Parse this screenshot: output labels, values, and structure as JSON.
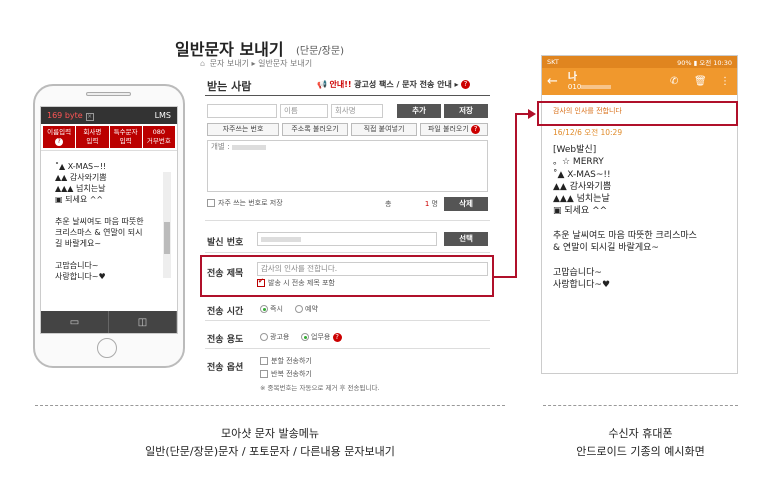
{
  "heading": {
    "title": "일반문자 보내기",
    "subtitle": "(단문/장문)",
    "breadcrumb_1": "문자 보내기",
    "breadcrumb_2": "일반문자 보내기"
  },
  "left_phone": {
    "byte_count": "169 byte",
    "mode": "LMS",
    "tabs": [
      "이름입력",
      "회사명\n입력",
      "특수문자\n입력",
      "080\n거부번호"
    ],
    "message": "˚▲  X-MAS~!!\n▲▲ 감사와기쁨\n▲▲▲ 넘치는날\n ▣  되세요 ^^\n\n추운 날씨여도 마음 따뜻한\n크리스마스 & 연말이 되시\n길 바랄게요~\n\n고맙습니다~\n사랑합니다~♥"
  },
  "form": {
    "recipient_label": "받는 사람",
    "notice_label": "안내!!",
    "notice_text": "광고성 팩스 / 문자 전송 안내",
    "phone_placeholder": "",
    "name_placeholder": "이름",
    "company_placeholder": "회사명",
    "add_button": "추가",
    "save_button": "저장",
    "btn_frequent": "자주쓰는 번호",
    "btn_address": "주소록 불러오기",
    "btn_direct": "직접 붙여넣기",
    "btn_file": "파일 불러오기",
    "recipient_list_prefix": "개별 : ",
    "save_frequent_label": "자주 쓰는 번호로 저장",
    "total_label": "총",
    "total_count": "1",
    "total_unit": "명",
    "delete_button": "삭제",
    "sender_label": "발신 번호",
    "select_button": "선택",
    "subject_label": "전송 제목",
    "subject_value": "감사의 인사를 전합니다.",
    "include_subject_label": "발송 시 전송 제목 포함",
    "time_label": "전송 시간",
    "time_now": "즉시",
    "time_reserve": "예약",
    "purpose_label": "전송 용도",
    "purpose_ad": "광고용",
    "purpose_business": "업무용",
    "option_label": "전송 옵션",
    "option_split": "분할 전송하기",
    "option_repeat": "반복 전송하기",
    "option_note": "※ 중복번호는 자동으로 제거 후 전송됩니다."
  },
  "right_phone": {
    "carrier": "SKT",
    "clock": "90% ▮ 오전 10:30",
    "contact_name": "나",
    "contact_number": "010",
    "subject": "감사의 인사를 전합니다",
    "date": "16/12/6  오전 10:29",
    "body": "[Web발신]\n。☆    MERRY\n˚▲   X-MAS~!!\n ▲▲ 감사와기쁨\n▲▲▲ 넘치는날\n   ▣   되세요 ^^\n\n추운 날씨여도 마음 따뜻한 크리스마스\n& 연말이 되시길 바랄게요~\n\n고맙습니다~\n사랑합니다~♥"
  },
  "captions": {
    "left_1": "모아샷 문자 발송메뉴",
    "left_2": "일반(단문/장문)문자 / 포토문자 / 다른내용 문자보내기",
    "right_1": "수신자 휴대폰",
    "right_2": "안드로이드 기종의 예시화면"
  },
  "colors": {
    "accent_red": "#b0102a",
    "android_orange": "#f0982d"
  }
}
